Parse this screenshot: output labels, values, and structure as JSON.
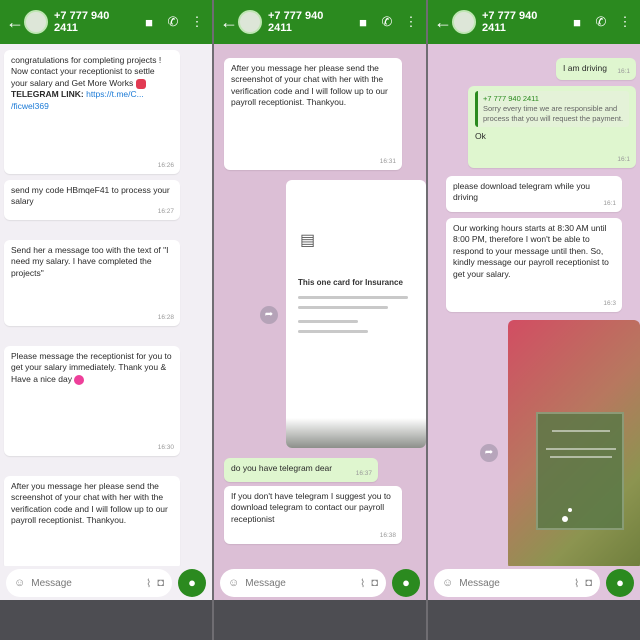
{
  "header": {
    "phone": "+7 777 940 2411",
    "status": "",
    "back_icon": "arrow-left-icon",
    "video_icon": "video-call-icon",
    "call_icon": "phone-icon",
    "menu_icon": "more-vertical-icon",
    "color": "#2b8a1f"
  },
  "input": {
    "placeholder": "Message",
    "emoji_icon": "emoji-icon",
    "attach_icon": "paperclip-icon",
    "camera_icon": "camera-icon",
    "mic_icon": "microphone-icon"
  },
  "panel1": {
    "m1": {
      "text": "congratulations for completing projects ! Now contact your receptionist to settle your salary and Get More Works",
      "link_label": "TELEGRAM LINK:",
      "link": "https://t.me/C...",
      "link2": "/ficwel369",
      "time": "16:26"
    },
    "m2": {
      "text": "send my code HBmqeF41 to process your salary",
      "time": "16:27"
    },
    "m3": {
      "text": "Send her a message too with the text of \"I need my salary. I have completed the projects\"",
      "time": "16:28"
    },
    "m4": {
      "text": "Please message the receptionist for you to get your salary immediately. Thank you & Have a nice day",
      "time": "16:30"
    },
    "m5": {
      "text": "After you message her please send the screenshot of your chat with her with the verification code and I will follow up to our payroll receptionist. Thankyou."
    }
  },
  "panel2": {
    "m1": {
      "text": "After you message her please send the screenshot of your chat with her with the verification code and I will follow up to our payroll receptionist. Thankyou.",
      "time": "16:31"
    },
    "doc": {
      "title": "This one card for Insurance"
    },
    "m2": {
      "text": "do you have telegram dear",
      "time": "16:37"
    },
    "m3": {
      "text": "If you don't have telegram I suggest you to download telegram to contact our payroll receptionist",
      "time": "16:38"
    }
  },
  "panel3": {
    "m1": {
      "text": "I am driving",
      "time": "16:1"
    },
    "m2": {
      "quote_name": "+7 777 940 2411",
      "quote_text": "Sorry every time we are responsible and process that you will request the payment.",
      "text": "Ok",
      "time": "16:1"
    },
    "m3": {
      "text": "please download telegram while you driving",
      "time": "16:1"
    },
    "m4": {
      "text": "Our working hours starts at 8:30 AM until 8:00 PM, therefore I won't be able to respond to your message until then. So, kindly message our payroll receptionist to get your salary.",
      "time": "16:3"
    }
  }
}
